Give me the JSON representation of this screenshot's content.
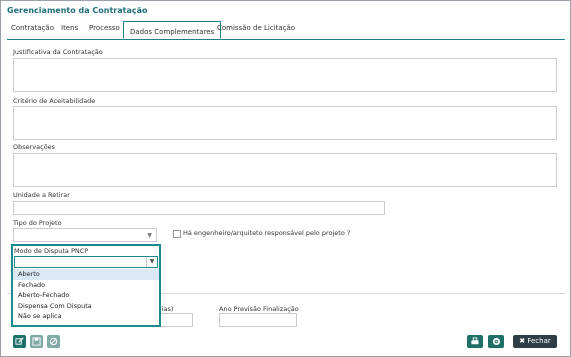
{
  "title": "Gerenciamento da Contratação",
  "tabs": [
    "Contratação",
    "Itens",
    "Processo",
    "Dados Complementares",
    "Comissão de Licitação"
  ],
  "fields": {
    "justificativa": "Justificativa da Contratação",
    "criterio": "Critério de Aceitabilidade",
    "observacoes": "Observações",
    "unidade": "Unidade a Retirar",
    "tipo_projeto": "Tipo do Projeto",
    "engenheiro": "Há engenheiro/arquiteto responsável pelo projeto ?",
    "modo_disputa": "Modo de Disputa PNCP",
    "partial_dias": "(dias)",
    "ano_previsao": "Ano Previsão Finalização"
  },
  "dropdown_options": [
    "Aberto",
    "Fechado",
    "Aberto-Fechado",
    "Dispensa Com Disputa",
    "Não se aplica"
  ],
  "buttons": {
    "fechar": "Fechar"
  }
}
